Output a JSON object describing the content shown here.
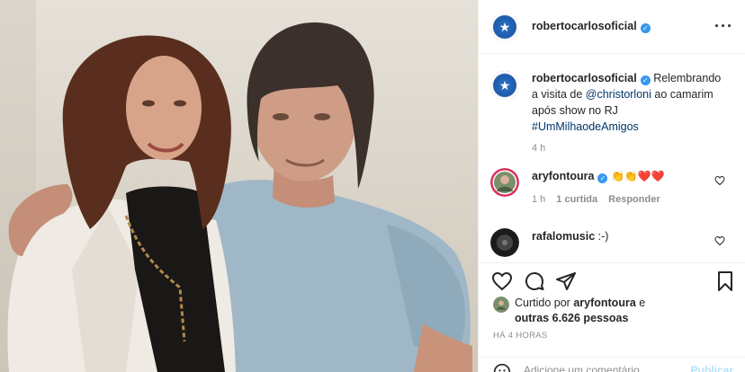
{
  "post": {
    "username": "robertocarlosoficial",
    "caption": {
      "username": "robertocarlosoficial",
      "text_before": "Relembrando a visita de ",
      "mention": "@christorloni",
      "text_after": " ao camarim após show no RJ",
      "hashtag": "#UmMilhaodeAmigos",
      "time": "4 h"
    },
    "comments": [
      {
        "username": "aryfontoura",
        "text": "👏👏❤️❤️",
        "time": "1 h",
        "likes": "1 curtida",
        "reply": "Responder"
      },
      {
        "username": "rafalomusic",
        "text": ":-)"
      }
    ],
    "likes": {
      "prefix": "Curtido por ",
      "user": "aryfontoura",
      "conj": " e",
      "others": "outras 6.626 pessoas"
    },
    "posted_ago": "HÁ 4 HORAS",
    "comment_box": {
      "placeholder": "Adicione um comentário...",
      "publish": "Publicar"
    }
  },
  "colors": {
    "verified": "#3897f0",
    "link": "#00376b",
    "muted": "#8e8e8e",
    "publish_disabled": "#b2dffc"
  }
}
